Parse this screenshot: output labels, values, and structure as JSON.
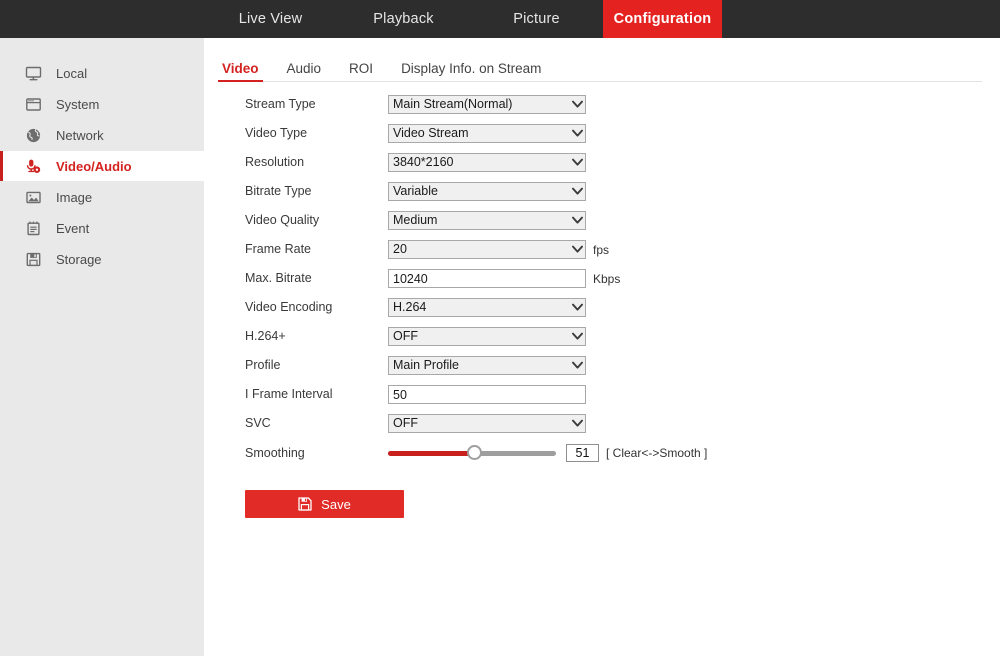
{
  "topnav": {
    "items": [
      {
        "label": "Live View",
        "active": false
      },
      {
        "label": "Playback",
        "active": false
      },
      {
        "label": "Picture",
        "active": false
      },
      {
        "label": "Configuration",
        "active": true
      }
    ],
    "background_color": "#2d2d2d",
    "active_color": "#e42320"
  },
  "sidebar": {
    "background_color": "#e9e9e9",
    "active_color": "#d3221f",
    "items": [
      {
        "label": "Local",
        "icon": "monitor-icon",
        "active": false
      },
      {
        "label": "System",
        "icon": "window-icon",
        "active": false
      },
      {
        "label": "Network",
        "icon": "globe-icon",
        "active": false
      },
      {
        "label": "Video/Audio",
        "icon": "microphone-icon",
        "active": true
      },
      {
        "label": "Image",
        "icon": "picture-icon",
        "active": false
      },
      {
        "label": "Event",
        "icon": "clipboard-icon",
        "active": false
      },
      {
        "label": "Storage",
        "icon": "floppy-icon",
        "active": false
      }
    ]
  },
  "subtabs": {
    "items": [
      {
        "label": "Video",
        "active": true
      },
      {
        "label": "Audio",
        "active": false
      },
      {
        "label": "ROI",
        "active": false
      },
      {
        "label": "Display Info. on Stream",
        "active": false
      }
    ]
  },
  "form": {
    "rows": [
      {
        "label": "Stream Type",
        "type": "select",
        "value": "Main Stream(Normal)",
        "unit": ""
      },
      {
        "label": "Video Type",
        "type": "select",
        "value": "Video Stream",
        "unit": ""
      },
      {
        "label": "Resolution",
        "type": "select",
        "value": "3840*2160",
        "unit": ""
      },
      {
        "label": "Bitrate Type",
        "type": "select",
        "value": "Variable",
        "unit": ""
      },
      {
        "label": "Video Quality",
        "type": "select",
        "value": "Medium",
        "unit": ""
      },
      {
        "label": "Frame Rate",
        "type": "select",
        "value": "20",
        "unit": "fps"
      },
      {
        "label": "Max. Bitrate",
        "type": "text",
        "value": "10240",
        "unit": "Kbps"
      },
      {
        "label": "Video Encoding",
        "type": "select",
        "value": "H.264",
        "unit": ""
      },
      {
        "label": "H.264+",
        "type": "select",
        "value": "OFF",
        "unit": ""
      },
      {
        "label": "Profile",
        "type": "select",
        "value": "Main Profile",
        "unit": ""
      },
      {
        "label": "I Frame Interval",
        "type": "text",
        "value": "50",
        "unit": ""
      },
      {
        "label": "SVC",
        "type": "select",
        "value": "OFF",
        "unit": ""
      }
    ],
    "smoothing": {
      "label": "Smoothing",
      "value": "51",
      "min": 1,
      "max": 100,
      "percent": 51,
      "hint": "[ Clear<->Smooth ]",
      "fill_color": "#c8201d",
      "track_color": "#9e9e9e"
    }
  },
  "actions": {
    "save_label": "Save",
    "save_color": "#e02b26",
    "save_icon": "floppy-save-icon"
  }
}
